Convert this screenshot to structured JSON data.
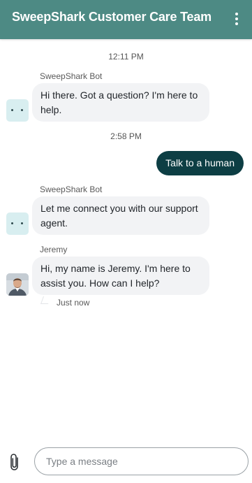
{
  "header": {
    "title": "SweepShark Customer Care Team",
    "menu_icon": "more-vertical-icon",
    "background": "#4d8a84"
  },
  "conversation": {
    "timestamp_1": "12:11 PM",
    "bot_message_1": {
      "sender": "SweepShark Bot",
      "text": "Hi there. Got a question? I'm here to help."
    },
    "timestamp_2": "2:58 PM",
    "user_message": {
      "text": "Talk to a human",
      "background": "#0d3e44"
    },
    "bot_message_2": {
      "sender": "SweepShark Bot",
      "text": "Let me connect you with our support agent."
    },
    "agent_message": {
      "sender": "Jeremy",
      "text": "Hi, my name is Jeremy. I'm here to assist you. How can I help?",
      "status": "Just now"
    }
  },
  "composer": {
    "attach_icon": "paperclip-icon",
    "placeholder": "Type a message",
    "value": ""
  }
}
